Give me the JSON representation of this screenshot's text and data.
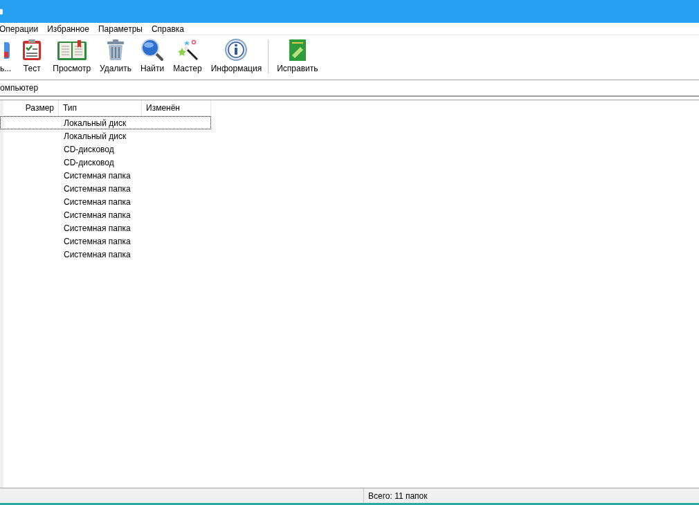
{
  "menu": [
    "Операции",
    "Избранное",
    "Параметры",
    "Справка"
  ],
  "toolbar": [
    {
      "kind": "partial",
      "label": "ь..."
    },
    {
      "kind": "test",
      "label": "Тест"
    },
    {
      "kind": "view",
      "label": "Просмотр"
    },
    {
      "kind": "delete",
      "label": "Удалить"
    },
    {
      "kind": "find",
      "label": "Найти"
    },
    {
      "kind": "wizard",
      "label": "Мастер"
    },
    {
      "kind": "info",
      "label": "Информация"
    },
    {
      "kind": "separator"
    },
    {
      "kind": "repair",
      "label": "Исправить"
    }
  ],
  "address": "омпьютер",
  "table": {
    "columns": [
      "Размер",
      "Тип",
      "Изменён"
    ],
    "rows": [
      {
        "type": "Локальный диск",
        "focused": true
      },
      {
        "type": "Локальный диск",
        "focused": false
      },
      {
        "type": "CD-дисковод",
        "focused": false
      },
      {
        "type": "CD-дисковод",
        "focused": false
      },
      {
        "type": "Системная папка",
        "focused": false
      },
      {
        "type": "Системная папка",
        "focused": false
      },
      {
        "type": "Системная папка",
        "focused": false
      },
      {
        "type": "Системная папка",
        "focused": false
      },
      {
        "type": "Системная папка",
        "focused": false
      },
      {
        "type": "Системная папка",
        "focused": false
      },
      {
        "type": "Системная папка",
        "focused": false
      }
    ]
  },
  "status_bar": "Всего: 11 папок"
}
